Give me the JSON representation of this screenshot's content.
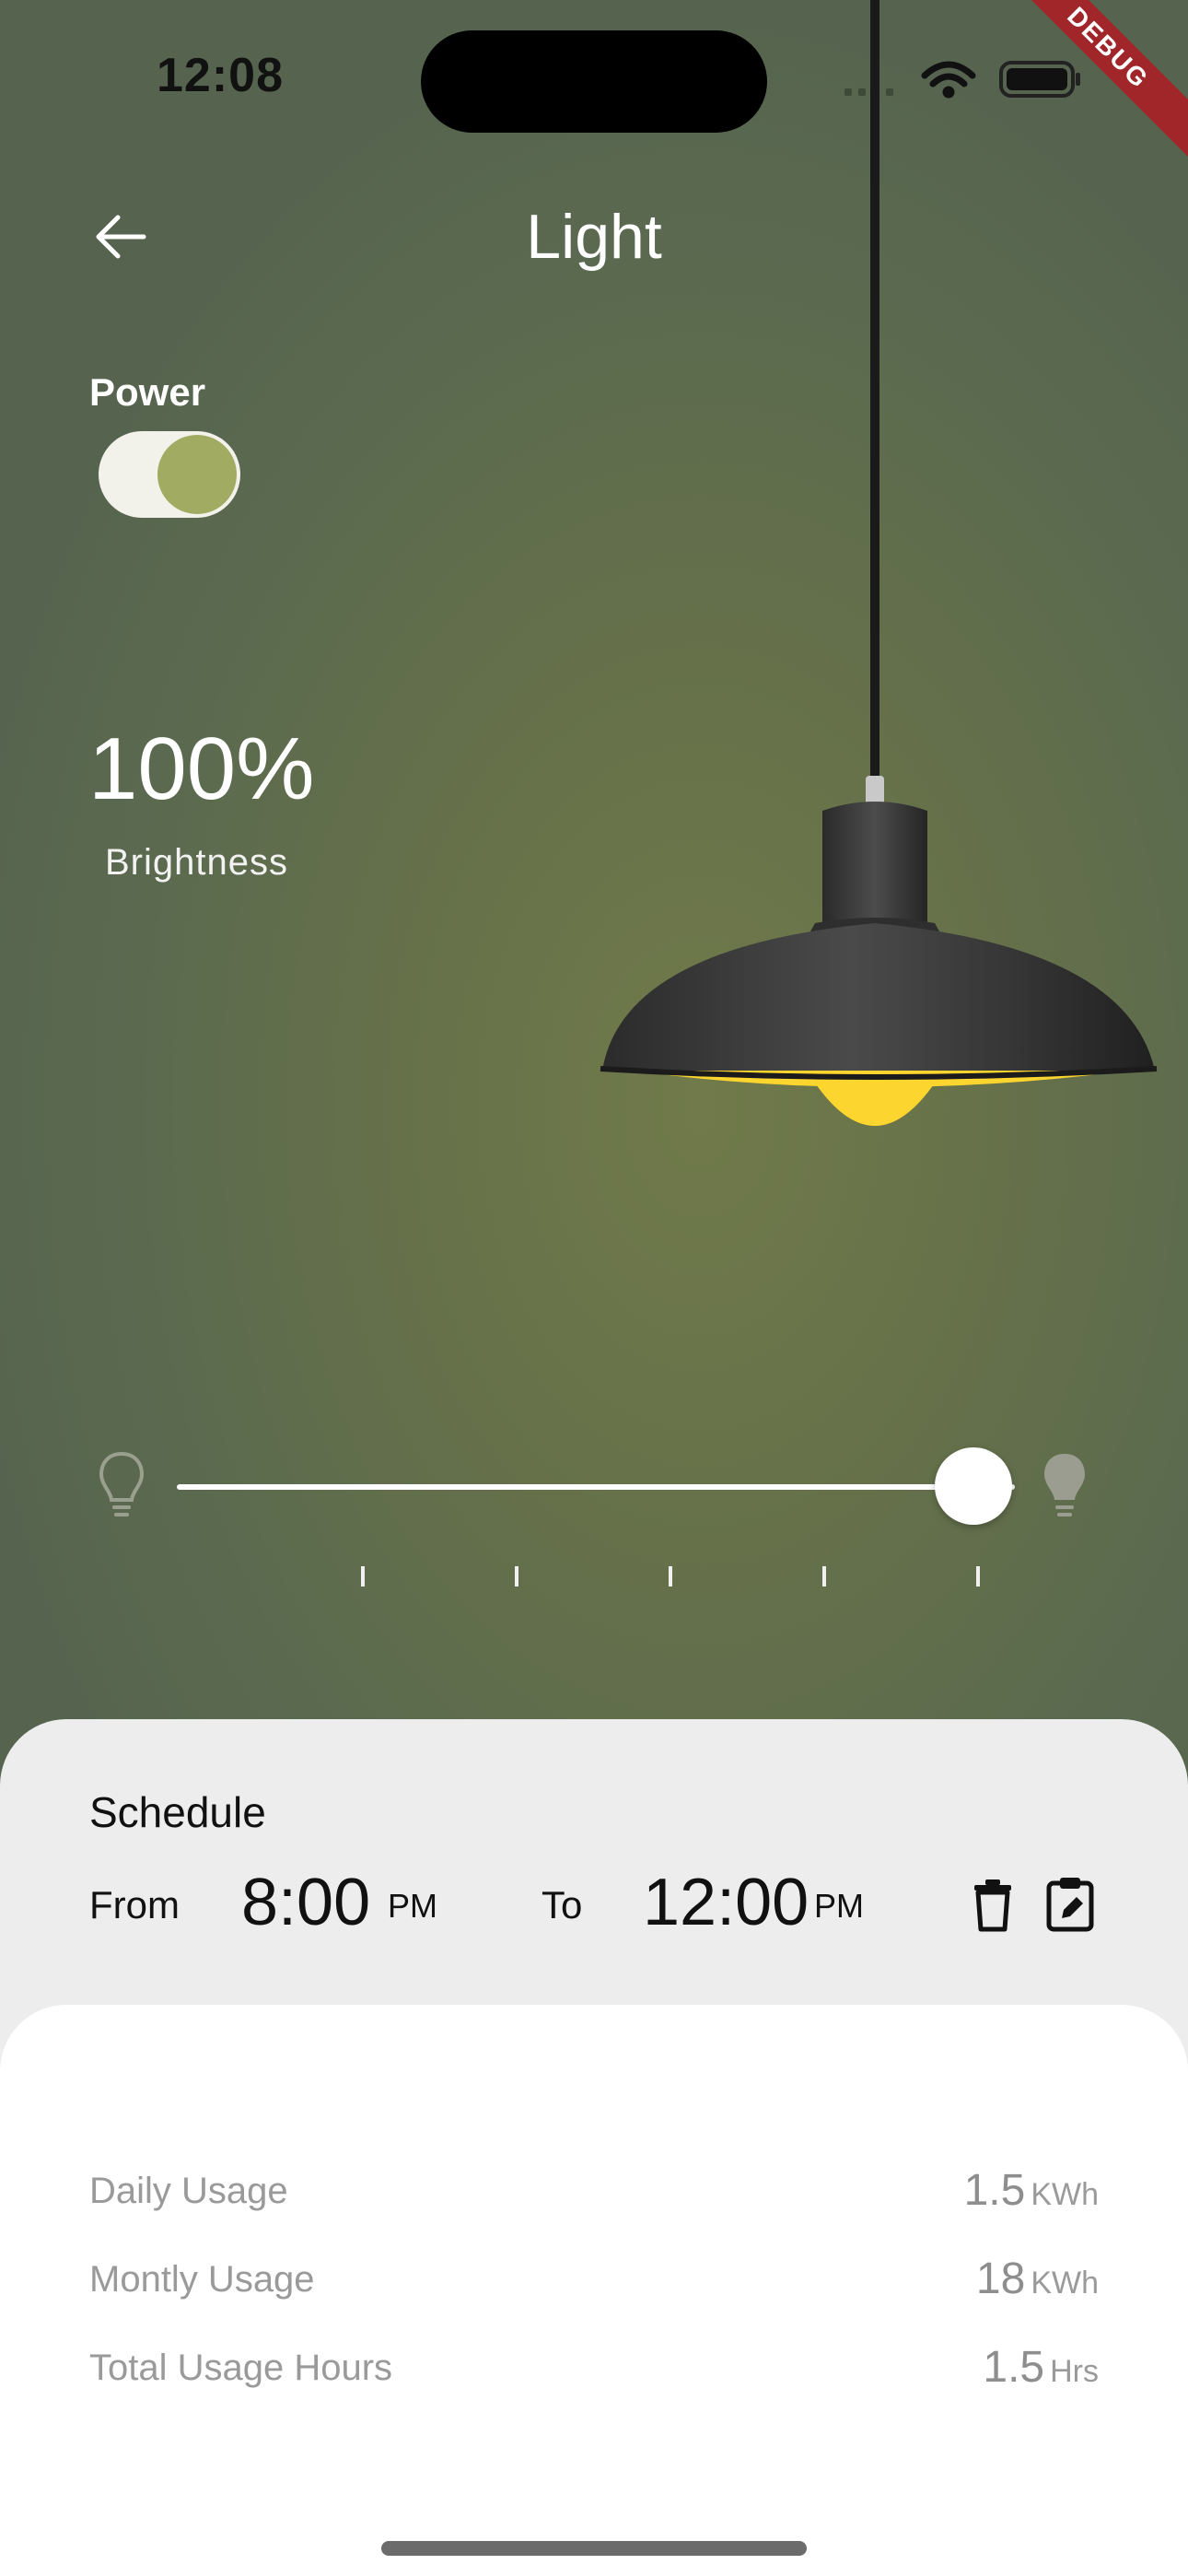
{
  "status_bar": {
    "time": "12:08",
    "debug": "DEBUG"
  },
  "header": {
    "title": "Light"
  },
  "power": {
    "label": "Power",
    "on": true
  },
  "brightness": {
    "value": "100%",
    "label": "Brightness",
    "level": 1.0
  },
  "slider": {
    "ticks": 5
  },
  "schedule": {
    "title": "Schedule",
    "from_label": "From",
    "from_time": "8:00",
    "from_ampm": "PM",
    "to_label": "To",
    "to_time": "12:00",
    "to_ampm": "PM"
  },
  "usage": [
    {
      "label": "Daily Usage",
      "value": "1.5",
      "unit": "KWh"
    },
    {
      "label": "Montly Usage",
      "value": "18",
      "unit": "KWh"
    },
    {
      "label": "Total Usage Hours",
      "value": "1.5",
      "unit": "Hrs"
    }
  ],
  "icons": {
    "back": "arrow-left-icon",
    "delete": "trash-icon",
    "edit": "edit-clipboard-icon",
    "bulb_off": "bulb-outline-icon",
    "bulb_on": "bulb-filled-icon"
  },
  "colors": {
    "background": "#5f6d4d",
    "toggle_knob": "#a2ab62",
    "lamp_light": "#fdd52f",
    "debug_banner": "#a0262a"
  }
}
